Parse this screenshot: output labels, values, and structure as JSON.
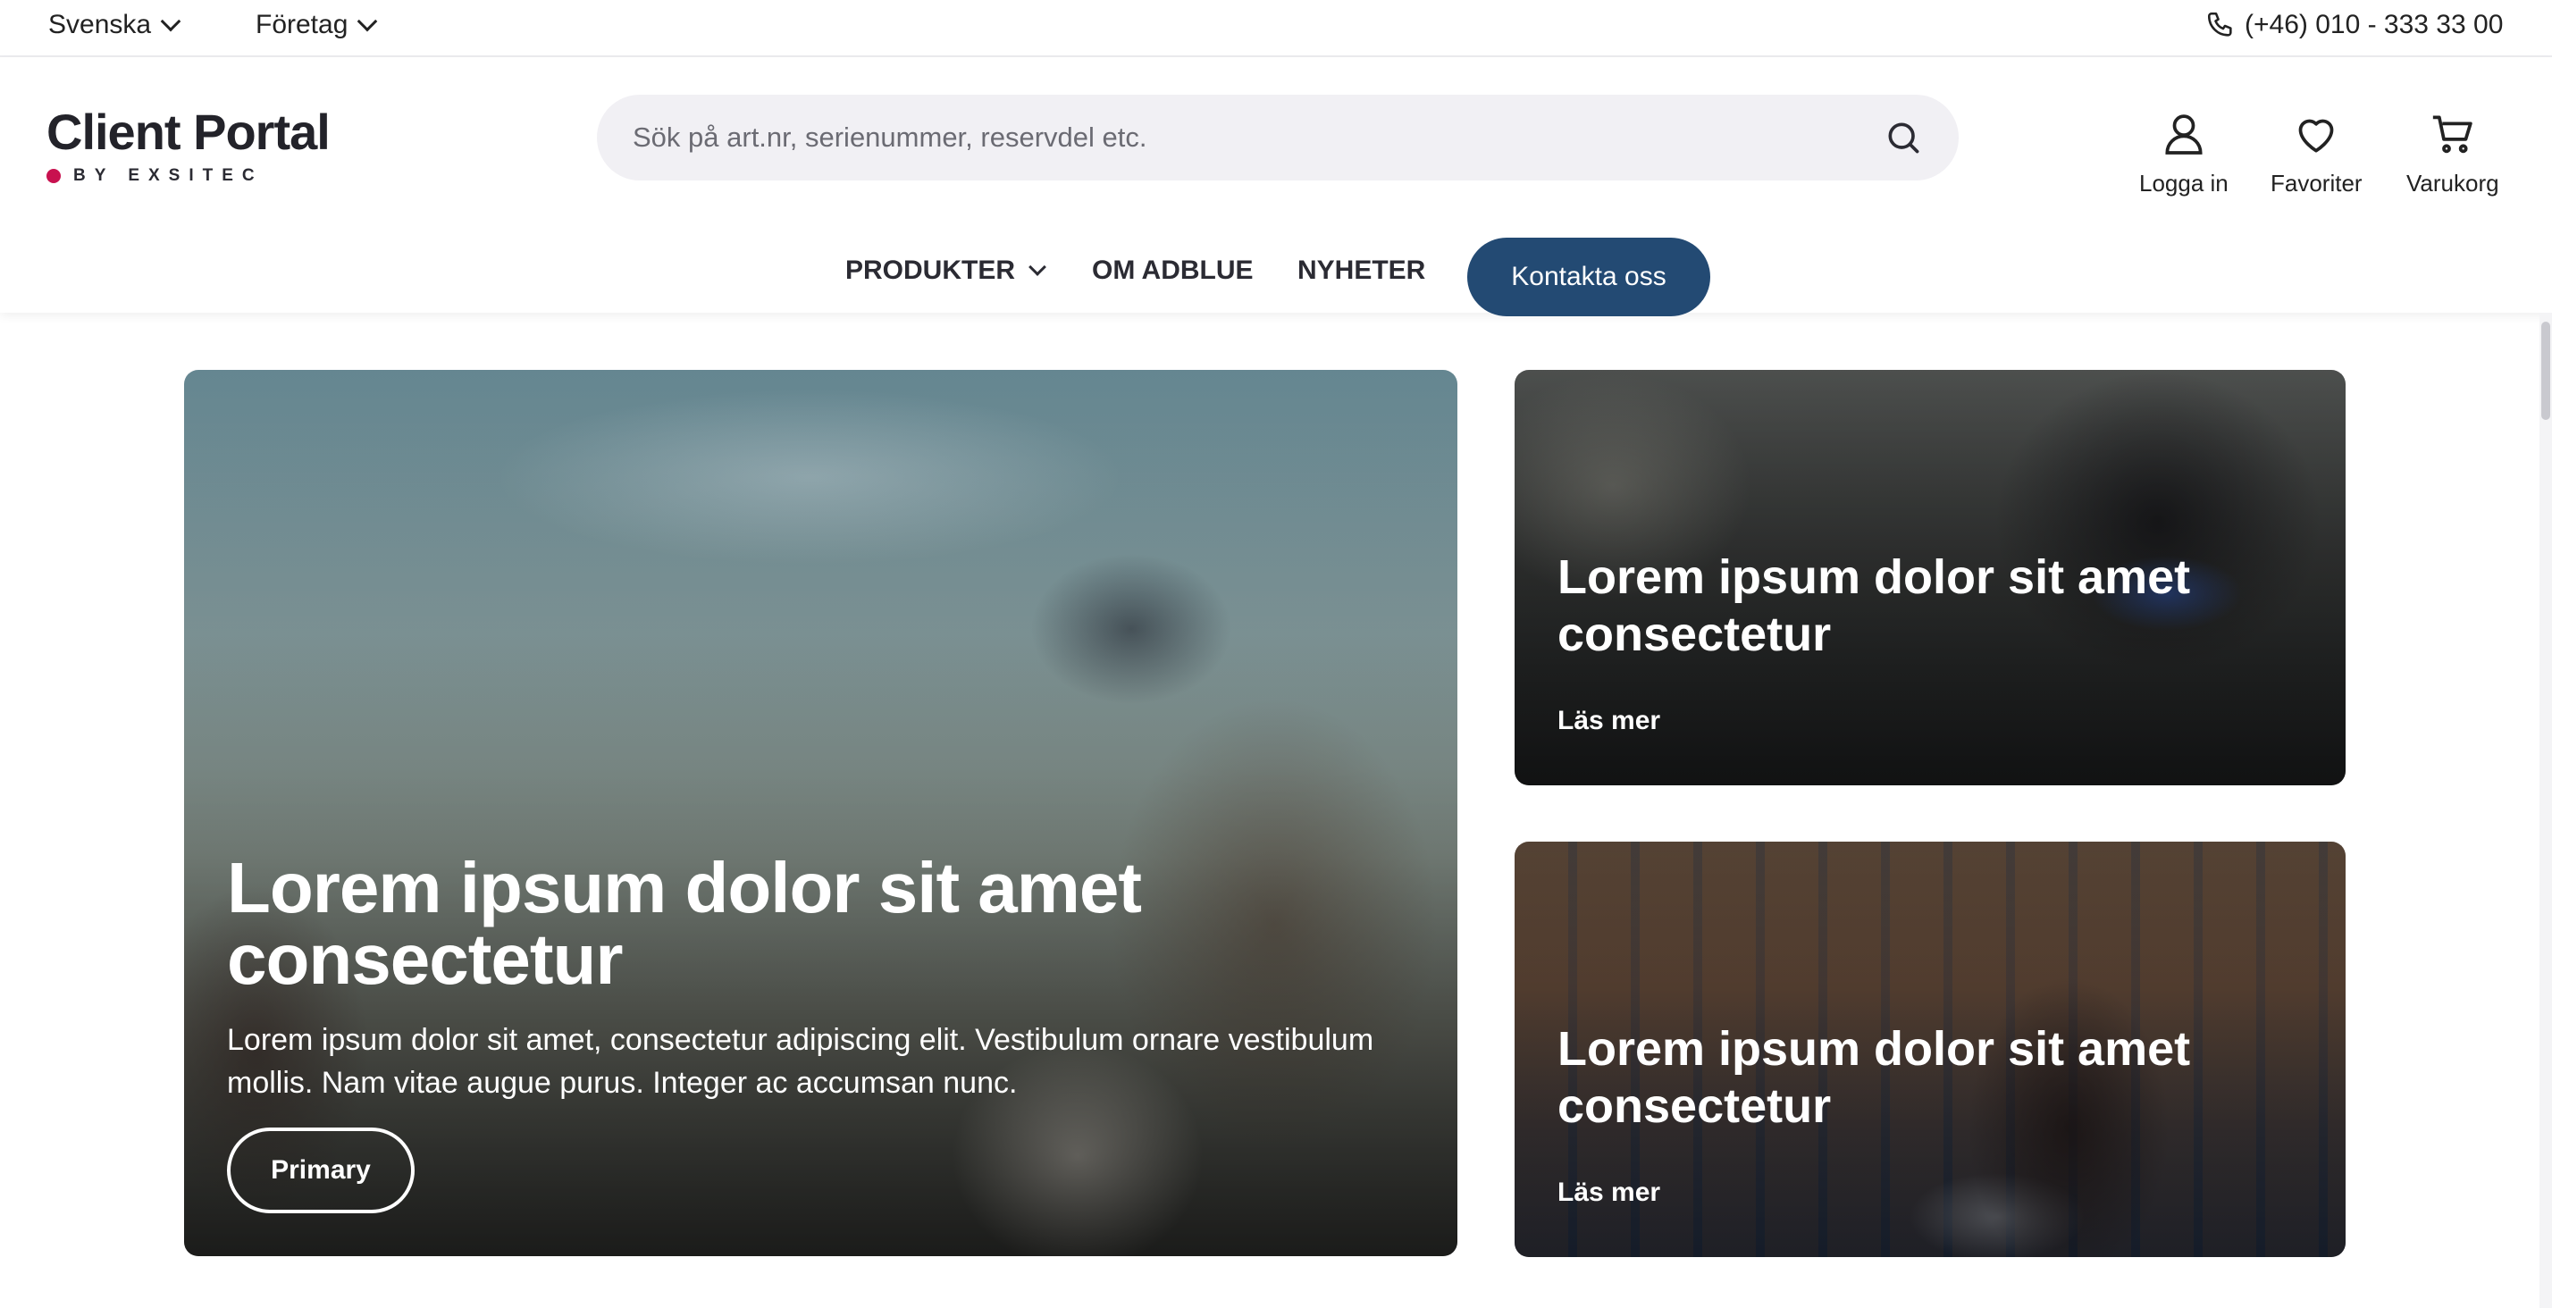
{
  "topbar": {
    "language": "Svenska",
    "company": "Företag",
    "phone": "(+46) 010 - 333 33 00"
  },
  "logo": {
    "title": "Client Portal",
    "subtitle": "BY EXSITEC",
    "dot_color": "#c8114f"
  },
  "search": {
    "placeholder": "Sök på art.nr, serienummer, reservdel etc."
  },
  "header_actions": {
    "login": "Logga in",
    "favorites": "Favoriter",
    "cart": "Varukorg"
  },
  "nav": {
    "products": "PRODUKTER",
    "about": "OM ADBLUE",
    "news": "NYHETER",
    "contact": "Kontakta oss",
    "contact_color": "#234a73"
  },
  "hero": {
    "title": "Lorem ipsum dolor sit amet consectetur",
    "text": "Lorem ipsum dolor sit amet, consectetur adipiscing elit. Vestibulum ornare vestibulum mollis. Nam vitae augue purus. Integer ac accumsan nunc.",
    "button": "Primary"
  },
  "side_cards": [
    {
      "title": "Lorem ipsum dolor sit amet consectetur",
      "link": "Läs mer"
    },
    {
      "title": "Lorem ipsum dolor sit amet consectetur",
      "link": "Läs mer"
    }
  ]
}
